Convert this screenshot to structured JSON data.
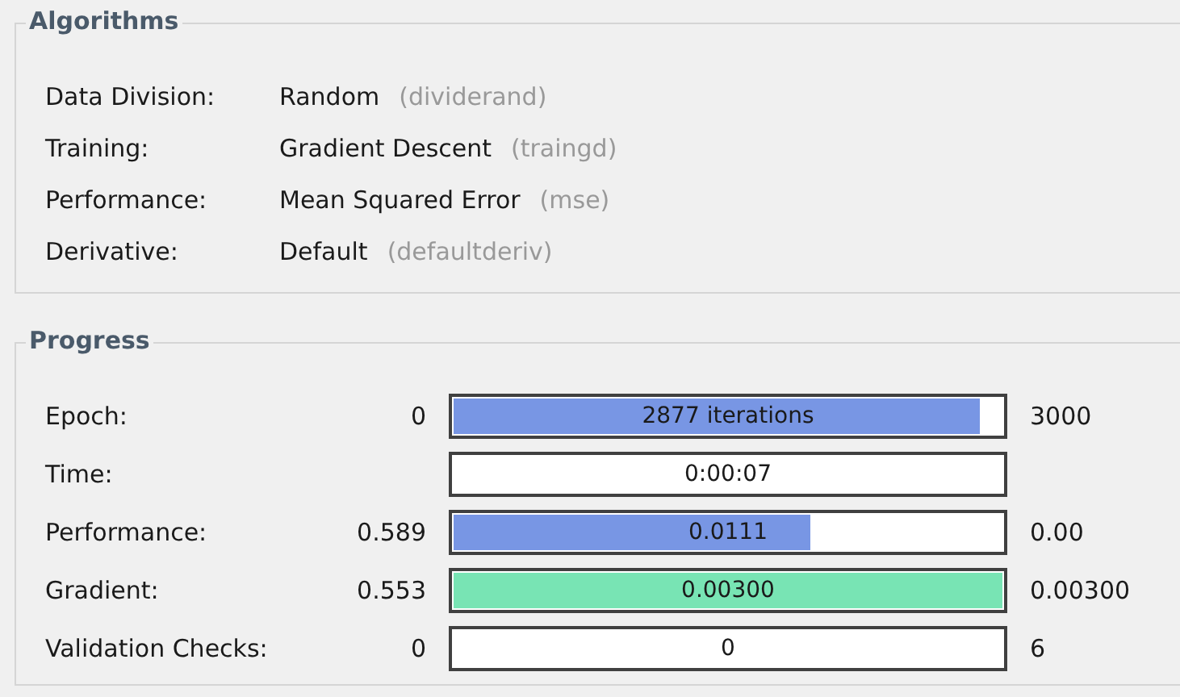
{
  "algorithms": {
    "title": "Algorithms",
    "rows": [
      {
        "label": "Data Division:",
        "value": "Random",
        "function": "(dividerand)"
      },
      {
        "label": "Training:",
        "value": "Gradient Descent",
        "function": "(traingd)"
      },
      {
        "label": "Performance:",
        "value": "Mean Squared Error",
        "function": "(mse)"
      },
      {
        "label": "Derivative:",
        "value": "Default",
        "function": "(defaultderiv)"
      }
    ]
  },
  "progress": {
    "title": "Progress",
    "rows": [
      {
        "label": "Epoch:",
        "start": "0",
        "bar_text": "2877 iterations",
        "level": 0.96,
        "color": "#7896e4",
        "end": "3000"
      },
      {
        "label": "Time:",
        "bar_text": "0:00:07",
        "level": 0
      },
      {
        "label": "Performance:",
        "start": "0.589",
        "bar_text": "0.0111",
        "level": 0.65,
        "color": "#7896e4",
        "end": "0.00"
      },
      {
        "label": "Gradient:",
        "start": "0.553",
        "bar_text": "0.00300",
        "level": 1,
        "color": "#78e4b4",
        "end": "0.00300"
      },
      {
        "label": "Validation Checks:",
        "start": "0",
        "bar_text": "0",
        "level": 0,
        "end": "6"
      }
    ]
  }
}
